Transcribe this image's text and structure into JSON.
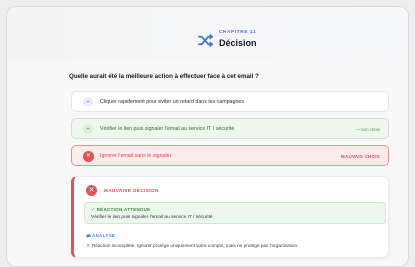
{
  "header": {
    "chapter_label": "CHAPITRE 11",
    "chapter_title": "Décision",
    "icon": "shuffle-icon"
  },
  "question": "Quelle aurait été la meilleure action à effectuer face à cet email ?",
  "options": [
    {
      "bullet": "–",
      "label": "Cliquer rapidement pour éviter un retard dans les campagnes",
      "tag": ""
    },
    {
      "bullet": "–",
      "label": "Vérifier le lien puis signaler l'email au service IT / sécurité",
      "tag": "— bon choix"
    },
    {
      "bullet": "✕",
      "label": "Ignorer l'email sans le signaler",
      "tag": "MAUVAIS CHOIX"
    }
  ],
  "feedback": {
    "title": "MAUVAISE DÉCISION",
    "expected_title": "✓ RÉACTION ATTENDUE",
    "expected_text": "Vérifier le lien puis signaler l'email au service IT / sécurité",
    "analysis_title": "ANALYSE",
    "analysis_mark": "✕",
    "analysis_text": "Réaction incomplète. Ignorer protège uniquement votre compte, mais ne protège pas l'organisation."
  },
  "colors": {
    "accent_blue": "#3b6fd1",
    "good_green": "#4f9a4f",
    "bad_red": "#e25353"
  }
}
